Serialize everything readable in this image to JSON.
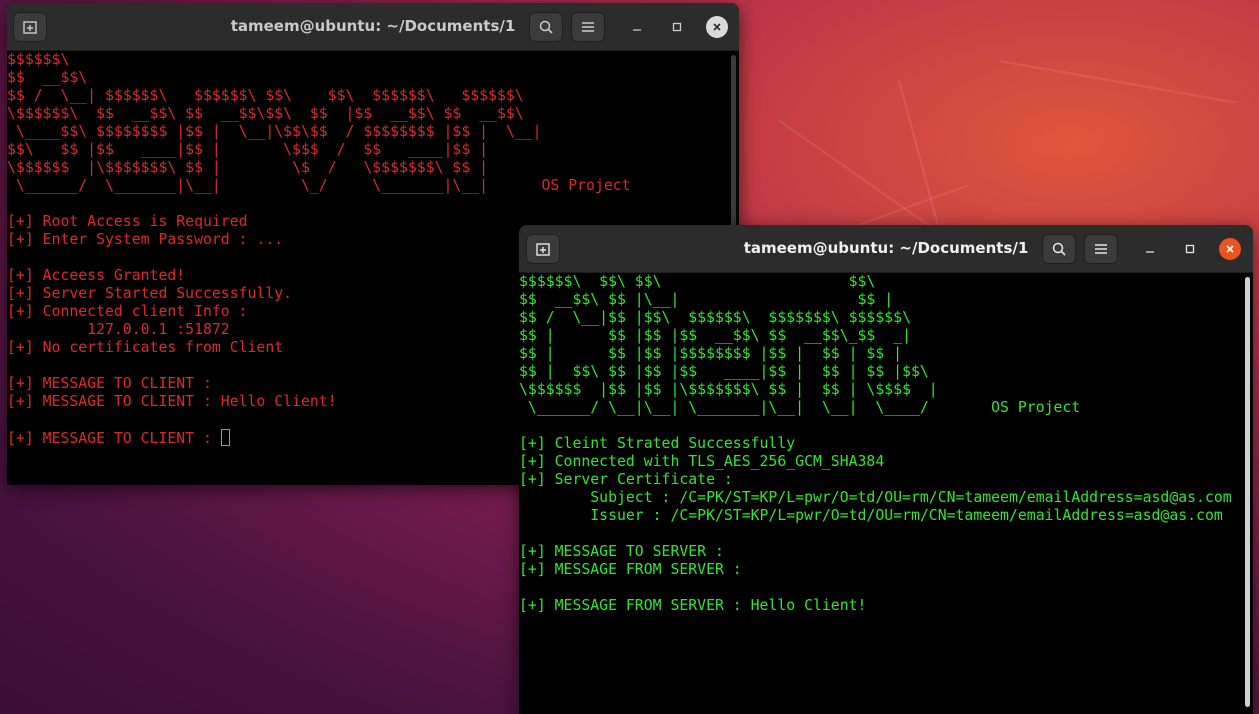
{
  "colors": {
    "server_text": "#e02828",
    "client_text": "#2ee82e",
    "titlebar": "#2c2c2c",
    "close_active": "#e95420"
  },
  "server_window": {
    "title": "tameem@ubuntu: ~/Documents/1",
    "lines": [
      "$$$$$$\\",
      "$$  __$$\\",
      "$$ /  \\__| $$$$$$\\   $$$$$$\\ $$\\    $$\\  $$$$$$\\   $$$$$$\\",
      "\\$$$$$$\\  $$  __$$\\ $$  __$$\\$$\\  $$  |$$  __$$\\ $$  __$$\\",
      " \\____$$\\ $$$$$$$$ |$$ |  \\__|\\$$\\$$  / $$$$$$$$ |$$ |  \\__|",
      "$$\\   $$ |$$   ____|$$ |       \\$$$  /  $$   ____|$$ |",
      "\\$$$$$$  |\\$$$$$$$\\ $$ |        \\$  /   \\$$$$$$$\\ $$ |",
      " \\______/  \\_______|\\__|         \\_/     \\_______|\\__|      OS Project",
      "",
      "[+] Root Access is Required",
      "[+] Enter System Password : ...",
      "",
      "[+] Acceess Granted!",
      "[+] Server Started Successfully.",
      "[+] Connected client Info :",
      "         127.0.0.1 :51872",
      "[+] No certificates from Client",
      "",
      "[+] MESSAGE TO CLIENT :",
      "[+] MESSAGE TO CLIENT : Hello Client!",
      "",
      "[+] MESSAGE TO CLIENT : "
    ]
  },
  "client_window": {
    "title": "tameem@ubuntu: ~/Documents/1",
    "lines": [
      "$$$$$$\\  $$\\ $$\\                     $$\\",
      "$$  __$$\\ $$ |\\__|                    $$ |",
      "$$ /  \\__|$$ |$$\\  $$$$$$\\  $$$$$$$\\ $$$$$$\\",
      "$$ |      $$ |$$ |$$  __$$\\ $$  __$$\\_$$  _|",
      "$$ |      $$ |$$ |$$$$$$$$ |$$ |  $$ | $$ |",
      "$$ |  $$\\ $$ |$$ |$$   ____|$$ |  $$ | $$ |$$\\",
      "\\$$$$$$  |$$ |$$ |\\$$$$$$$\\ $$ |  $$ | \\$$$$  |",
      " \\______/ \\__|\\__| \\_______|\\__|  \\__|  \\____/       OS Project",
      "",
      "[+] Cleint Strated Successfully",
      "[+] Connected with TLS_AES_256_GCM_SHA384",
      "[+] Server Certificate :",
      "        Subject : /C=PK/ST=KP/L=pwr/O=td/OU=rm/CN=tameem/emailAddress=asd@as.com",
      "        Issuer : /C=PK/ST=KP/L=pwr/O=td/OU=rm/CN=tameem/emailAddress=asd@as.com",
      "",
      "[+] MESSAGE TO SERVER :",
      "[+] MESSAGE FROM SERVER :",
      "",
      "[+] MESSAGE FROM SERVER : Hello Client!"
    ]
  },
  "icons": {
    "new_tab": "new-tab-icon",
    "search": "search-icon",
    "menu": "hamburger-menu-icon",
    "minimize": "minimize-icon",
    "maximize": "maximize-icon",
    "close": "close-icon"
  }
}
